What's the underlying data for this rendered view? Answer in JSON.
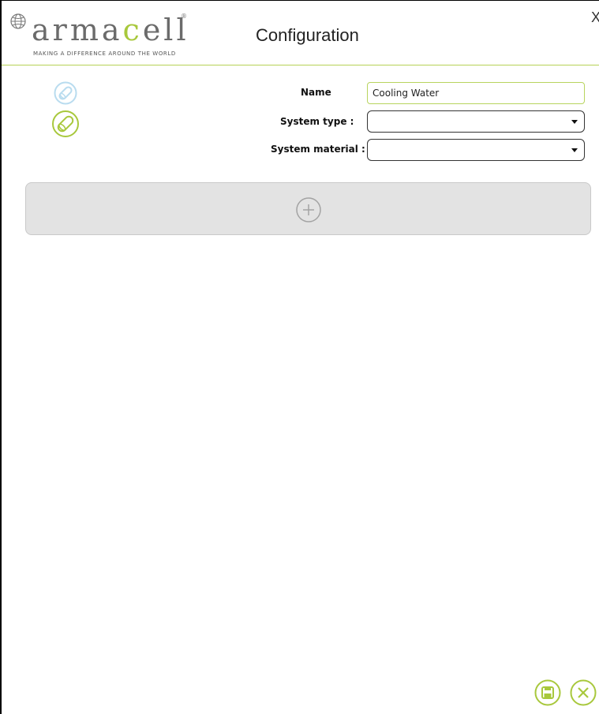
{
  "header": {
    "logo_prefix": "arma",
    "logo_accent": "c",
    "logo_suffix": "ell",
    "logo_tagline": "MAKING A DIFFERENCE AROUND THE WORLD",
    "title": "Configuration",
    "close_label": "X"
  },
  "form": {
    "name_label": "Name",
    "name_value": "Cooling Water",
    "system_type_label": "System type :",
    "system_type_value": "",
    "system_material_label": "System material :",
    "system_material_value": ""
  },
  "icons": {
    "pipe_faded": "pipe-icon",
    "pipe_active": "pipe-icon",
    "add": "plus-icon",
    "save": "save-icon",
    "cancel": "close-icon"
  },
  "colors": {
    "accent_green": "#a8c83c",
    "faded_blue": "#b9dcef",
    "panel_gray": "#e3e3e3"
  }
}
